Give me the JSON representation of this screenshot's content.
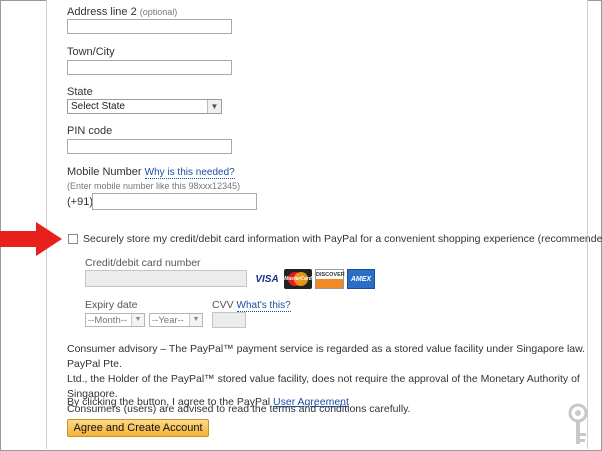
{
  "address2": {
    "label": "Address line 2",
    "optional": "(optional)",
    "value": ""
  },
  "city": {
    "label": "Town/City",
    "value": ""
  },
  "state": {
    "label": "State",
    "selected": "Select State"
  },
  "pin": {
    "label": "PIN code",
    "value": ""
  },
  "mobile": {
    "label": "Mobile Number",
    "help_link": "Why is this needed?",
    "hint": "(Enter mobile number like this 98xxx12345)",
    "prefix": "(+91)",
    "value": ""
  },
  "store_card": {
    "label": "Securely store my credit/debit card information with PayPal for a convenient shopping experience (recommended)",
    "checked": false
  },
  "card": {
    "number_label": "Credit/debit card number",
    "brands": [
      "VISA",
      "MasterCard",
      "DISCOVER",
      "AMEX"
    ],
    "expiry_label": "Expiry date",
    "month": "--Month--",
    "year": "--Year--",
    "cvv_label": "CVV",
    "cvv_link": "What's this?"
  },
  "advisory": {
    "line1": "Consumer advisory – The PayPal™ payment service is regarded as a stored value facility under Singapore law. PayPal Pte.",
    "line2": "Ltd., the Holder of the PayPal™ stored value facility, does not require the approval of the Monetary Authority of Singapore.",
    "line3": "Consumers (users) are advised to read the terms and conditions carefully."
  },
  "agreement": {
    "text": "By clicking the button, I agree to the PayPal",
    "link": "User Agreement"
  },
  "submit": {
    "label": "Agree and Create Account"
  },
  "colors": {
    "arrow": "#e8201c",
    "button": "#f5b335",
    "link": "#1a4e9e"
  },
  "icons": {
    "pointer": "red-arrow-icon",
    "watermark": "key-icon"
  }
}
